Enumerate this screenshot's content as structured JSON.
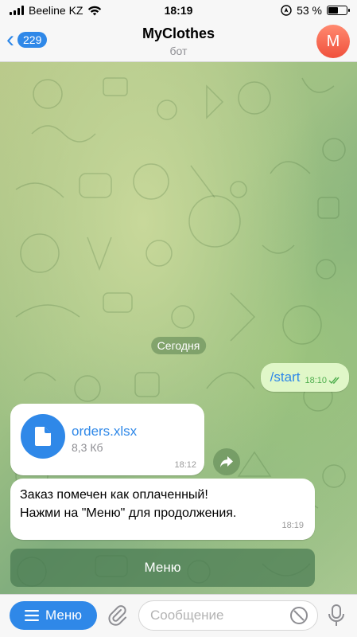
{
  "status_bar": {
    "carrier": "Beeline KZ",
    "time": "18:19",
    "battery": "53 %",
    "battery_level": 0.53
  },
  "header": {
    "back_count": "229",
    "title": "MyClothes",
    "subtitle": "бот",
    "avatar_letter": "M"
  },
  "chat": {
    "date_label": "Сегодня",
    "outgoing": {
      "text": "/start",
      "time": "18:10"
    },
    "file": {
      "name": "orders.xlsx",
      "size": "8,3 Кб",
      "time": "18:12"
    },
    "message": {
      "line1": "Заказ помечен как оплаченный!",
      "line2": "Нажми на \"Меню\" для продолжения.",
      "time": "18:19"
    },
    "keyboard_button": "Меню"
  },
  "input_bar": {
    "menu_label": "Меню",
    "placeholder": "Сообщение"
  },
  "colors": {
    "accent": "#2f88e8",
    "outgoing_bubble": "#e0f7c8",
    "read_check": "#4fae4e",
    "avatar": "#f0503c"
  },
  "icons": [
    "wifi-icon",
    "location-icon",
    "back-chevron-icon",
    "file-icon",
    "share-icon",
    "menu-lines-icon",
    "paperclip-icon",
    "sticker-icon",
    "microphone-icon",
    "double-check-icon"
  ]
}
